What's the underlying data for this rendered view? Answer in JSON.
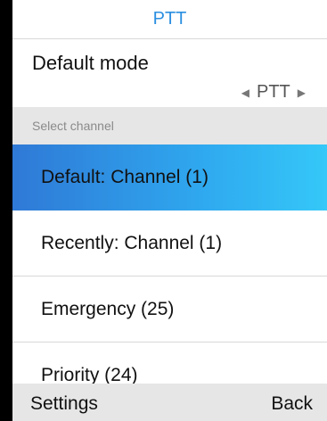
{
  "title": "PTT",
  "mode": {
    "label": "Default mode",
    "value": "PTT",
    "prev_icon": "triangle-left-icon",
    "next_icon": "triangle-right-icon"
  },
  "section_header": "Select channel",
  "channels": [
    {
      "label": "Default: Channel (1)",
      "selected": true
    },
    {
      "label": "Recently: Channel (1)",
      "selected": false
    },
    {
      "label": "Emergency (25)",
      "selected": false
    },
    {
      "label": "Priority (24)",
      "selected": false
    }
  ],
  "softkeys": {
    "left": "Settings",
    "right": "Back"
  },
  "colors": {
    "title": "#2b8fe0",
    "selected_start": "#2f79d6",
    "selected_end": "#35c8f8",
    "header_bg": "#e6e6e6"
  }
}
